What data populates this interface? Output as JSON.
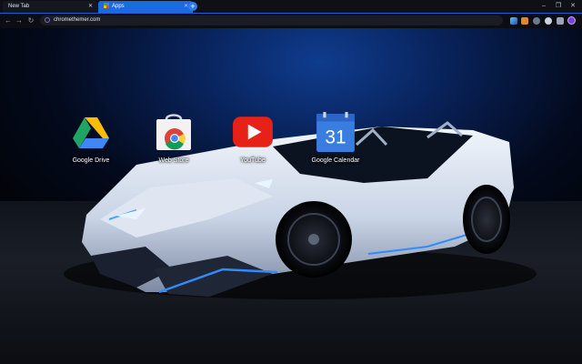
{
  "tabs": [
    {
      "label": "New Tab",
      "active": false
    },
    {
      "label": "Apps",
      "active": true
    }
  ],
  "toolbar": {
    "url": "chromethemer.com"
  },
  "apps": [
    {
      "label": "Google Drive",
      "icon": "google-drive-icon"
    },
    {
      "label": "Web Store",
      "icon": "web-store-icon"
    },
    {
      "label": "YouTube",
      "icon": "youtube-icon"
    },
    {
      "label": "Google Calendar",
      "icon": "google-calendar-icon",
      "day": "31"
    }
  ],
  "colors": {
    "accent": "#1b6ae0",
    "background": "#05070c"
  }
}
